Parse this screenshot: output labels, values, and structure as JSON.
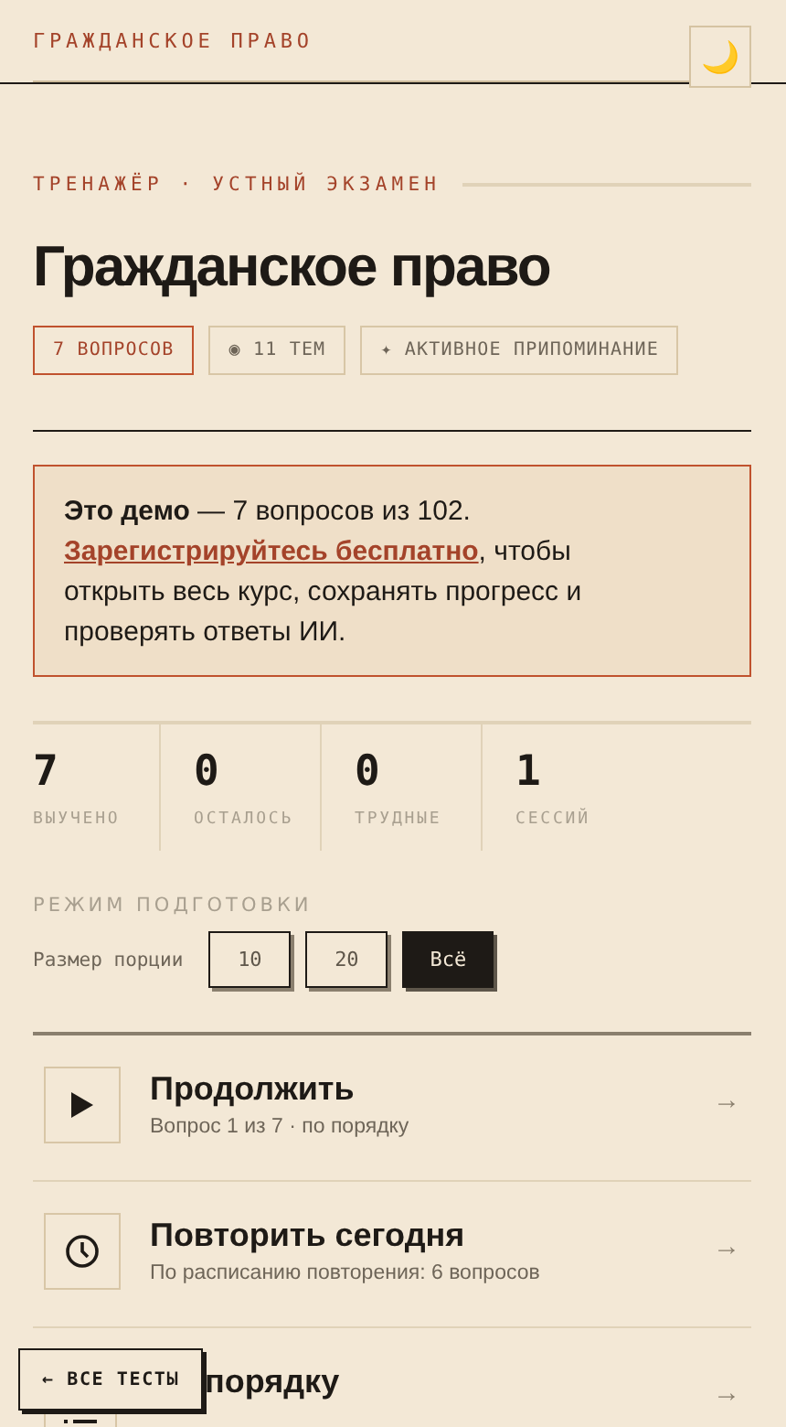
{
  "header": {
    "title": "ГРАЖДАНСКОЕ ПРАВО",
    "theme_button": "🌙"
  },
  "eyebrow": "ТРЕНАЖЁР · УСТНЫЙ ЭКЗАМЕН",
  "title": "Гражданское право",
  "chips": [
    {
      "label": "7 ВОПРОСОВ",
      "accent": true
    },
    {
      "label": "◉ 11 ТЕМ",
      "accent": false
    },
    {
      "label": "✦ АКТИВНОЕ ПРИПОМИНАНИЕ",
      "accent": false
    }
  ],
  "notice": {
    "text": "**Это демо** — 7 вопросов из 102.",
    "link": "Зарегистрируйтесь бесплатно",
    "rest": ", чтобы открыть весь курс, сохранять прогресс и проверять ответы ИИ."
  },
  "stats": [
    {
      "value": "7",
      "label": "ВЫУЧЕНО"
    },
    {
      "value": "0",
      "label": "ОСТАЛОСЬ"
    },
    {
      "value": "0",
      "label": "ТРУДНЫЕ"
    },
    {
      "value": "1",
      "label": "СЕССИЙ"
    }
  ],
  "mode": {
    "heading": "РЕЖИМ ПОДГОТОВКИ",
    "portion_label": "Размер порции",
    "options": [
      {
        "label": "10",
        "selected": false
      },
      {
        "label": "20",
        "selected": false
      },
      {
        "label": "Всё",
        "selected": true
      }
    ]
  },
  "actions": [
    {
      "kind": "play",
      "title": "Продолжить",
      "subtitle": "Вопрос 1 из 7 · по порядку",
      "arrow": "→"
    },
    {
      "kind": "clock",
      "title": "Повторить сегодня",
      "subtitle": "По расписанию повторения: 6 вопросов",
      "arrow": "→"
    },
    {
      "kind": "list",
      "title": "порядку",
      "arrow": "→"
    }
  ],
  "back_button": "← ВСЕ ТЕСТЫ"
}
